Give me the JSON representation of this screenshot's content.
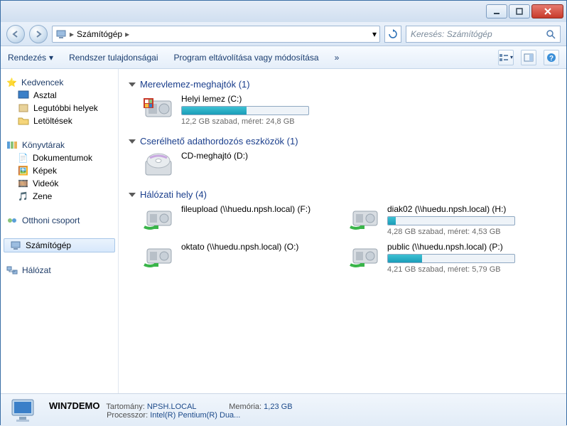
{
  "window": {
    "breadcrumb": [
      "Számítógép"
    ],
    "search_placeholder": "Keresés: Számítógép"
  },
  "toolbar": {
    "organize": "Rendezés",
    "system_props": "Rendszer tulajdonságai",
    "uninstall": "Program eltávolítása vagy módosítása",
    "more": "»"
  },
  "sidebar": {
    "favorites": {
      "label": "Kedvencek",
      "items": [
        "Asztal",
        "Legutóbbi helyek",
        "Letöltések"
      ]
    },
    "libraries": {
      "label": "Könyvtárak",
      "items": [
        "Dokumentumok",
        "Képek",
        "Videók",
        "Zene"
      ]
    },
    "homegroup": "Otthoni csoport",
    "computer": "Számítógép",
    "network": "Hálózat"
  },
  "categories": [
    {
      "title": "Merevlemez-meghajtók (1)",
      "drives": [
        {
          "name": "Helyi lemez (C:)",
          "icon": "hdd",
          "bar_pct": 51,
          "sub": "12,2 GB szabad, méret: 24,8 GB"
        }
      ]
    },
    {
      "title": "Cserélhető adathordozós eszközök (1)",
      "drives": [
        {
          "name": "CD-meghajtó (D:)",
          "icon": "cd",
          "sub": ""
        }
      ]
    },
    {
      "title": "Hálózati hely (4)",
      "drives": [
        {
          "name": "fileupload (\\\\huedu.npsh.local) (F:)",
          "icon": "net",
          "sub": ""
        },
        {
          "name": "diak02 (\\\\huedu.npsh.local) (H:)",
          "icon": "net",
          "bar_pct": 6,
          "sub": "4,28 GB szabad, méret: 4,53 GB"
        },
        {
          "name": "oktato (\\\\huedu.npsh.local) (O:)",
          "icon": "net",
          "sub": ""
        },
        {
          "name": "public (\\\\huedu.npsh.local) (P:)",
          "icon": "net",
          "bar_pct": 27,
          "sub": "4,21 GB szabad, méret: 5,79 GB"
        }
      ]
    }
  ],
  "status": {
    "name": "WIN7DEMO",
    "domain_label": "Tartomány:",
    "domain": "NPSH.LOCAL",
    "mem_label": "Memória:",
    "mem": "1,23 GB",
    "cpu_label": "Processzor:",
    "cpu": "Intel(R) Pentium(R) Dua..."
  }
}
